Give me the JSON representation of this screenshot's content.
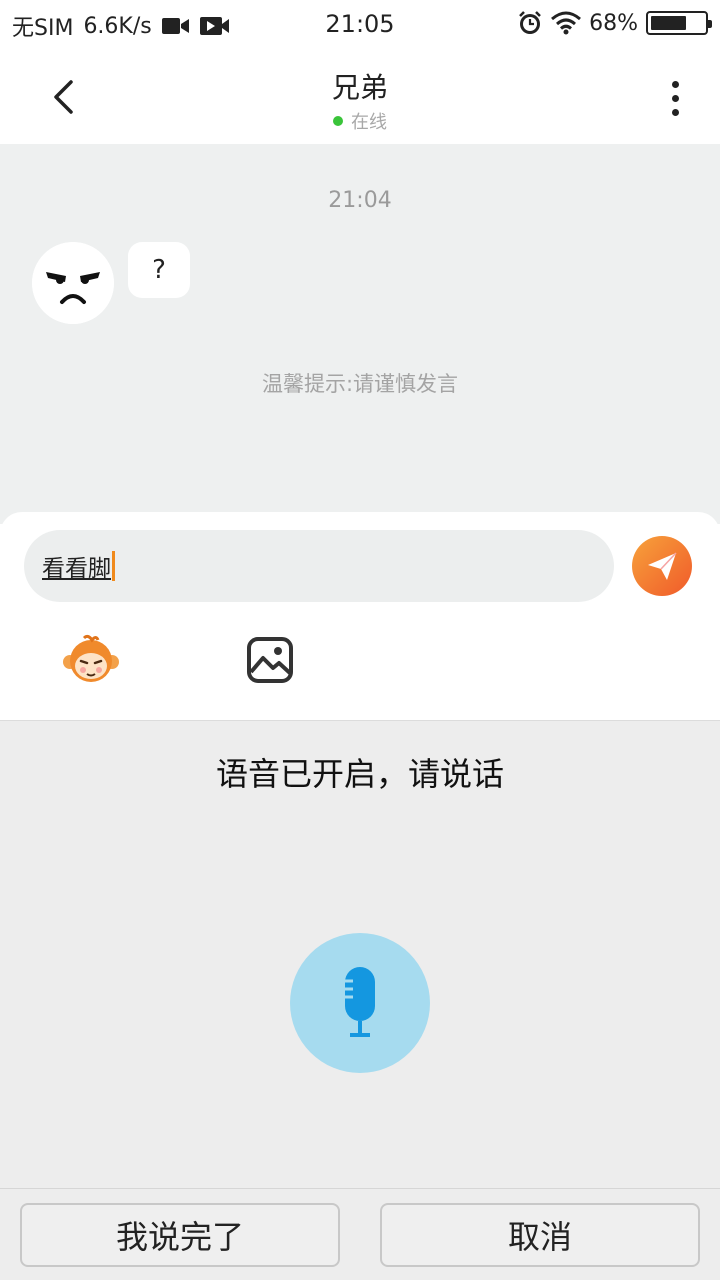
{
  "status_bar": {
    "carrier": "无SIM",
    "network_speed": "6.6K/s",
    "time": "21:05",
    "battery": "68%",
    "battery_level": 0.68,
    "icons": [
      "video-icon",
      "media-play-icon",
      "alarm-icon",
      "wifi-icon",
      "battery-icon"
    ]
  },
  "header": {
    "title": "兄弟",
    "status": "在线",
    "status_color": "#3ac43a"
  },
  "chat": {
    "timestamp": "21:04",
    "messages": [
      {
        "from": "other",
        "text": "?"
      }
    ],
    "notice": "温馨提示:请谨慎发言"
  },
  "composer": {
    "input_value": "看看脚",
    "accent_color": "#f05a2a"
  },
  "voice": {
    "prompt": "语音已开启，请说话",
    "mic_color": "#1497e0"
  },
  "buttons": {
    "done": "我说完了",
    "cancel": "取消"
  }
}
